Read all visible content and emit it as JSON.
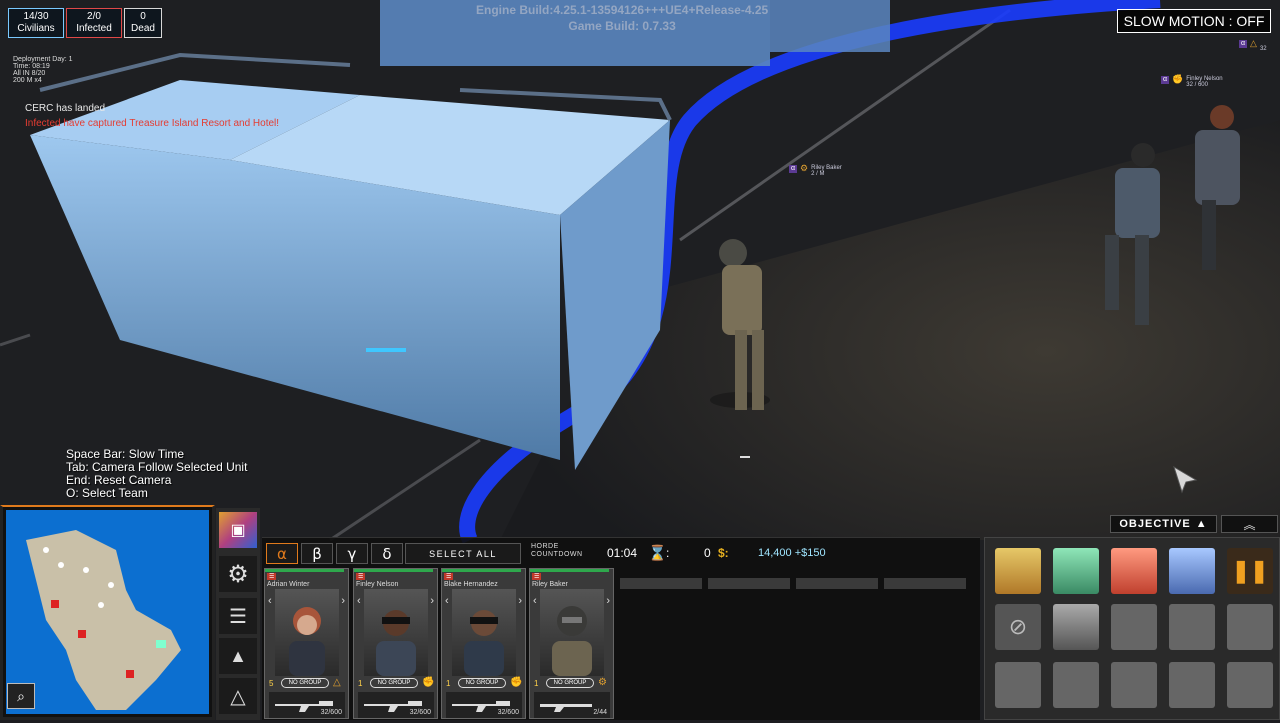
{
  "stats": {
    "civilians_value": "14/30",
    "civilians_label": "Civilians",
    "infected_value": "2/0",
    "infected_label": "Infected",
    "dead_value": "0",
    "dead_label": "Dead"
  },
  "deployment": {
    "title": "Deployment Day: 1",
    "time_label": "Time:",
    "time_value": "08:19",
    "row2_label": "All",
    "row2_value": "IN 8/20",
    "row3_label": "200 M",
    "row3_value": "x4"
  },
  "log": {
    "line1": "CERC has landed",
    "line2": "Infected have captured Treasure Island Resort and Hotel!"
  },
  "engine": {
    "line1": "Engine Build:4.25.1-13594126+++UE4+Release-4.25",
    "line2": "Game Build: 0.7.33"
  },
  "slow_motion": "SLOW MOTION : OFF",
  "tags": [
    {
      "greek": "α",
      "icon": "gear-icon",
      "name": "Riley Baker",
      "sub": "2 / M"
    },
    {
      "greek": "α",
      "icon": "fist-icon",
      "name": "Finley Nelson",
      "sub": "32 / 600"
    },
    {
      "greek": "α",
      "icon": "triangle-icon",
      "name": "",
      "sub": "32"
    }
  ],
  "hints": [
    "Space Bar: Slow Time",
    "Tab: Camera Follow Selected Unit",
    "End: Reset Camera",
    "O: Select Team"
  ],
  "teams": [
    "α",
    "β",
    "γ",
    "δ"
  ],
  "select_all": "SELECT ALL",
  "horde": {
    "line1": "HORDE",
    "line2": "COUNTDOWN",
    "time": "01:04"
  },
  "resources": {
    "hourglass_sep": ":",
    "count": "0",
    "dollar": "$:",
    "money": "14,400 +$150"
  },
  "units": [
    {
      "name": "Adrian Winter",
      "level": "5",
      "group": "NO GROUP",
      "role_icon": "triangle-icon",
      "ammo": "32/600",
      "hp": 0.95
    },
    {
      "name": "Finley Nelson",
      "level": "1",
      "group": "NO GROUP",
      "role_icon": "fist-icon",
      "ammo": "32/600",
      "hp": 0.95
    },
    {
      "name": "Blake Hernandez",
      "level": "1",
      "group": "NO GROUP",
      "role_icon": "fist-icon",
      "ammo": "32/600",
      "hp": 0.95
    },
    {
      "name": "Riley Baker",
      "level": "1",
      "group": "NO GROUP",
      "role_icon": "gear-icon",
      "ammo": "2/44",
      "hp": 0.95
    }
  ],
  "objective": "OBJECTIVE",
  "colors": {
    "accent": "#e07a1c",
    "blue_path": "#1a3cff",
    "money": "#9fe5ff",
    "infected": "#e04848"
  }
}
